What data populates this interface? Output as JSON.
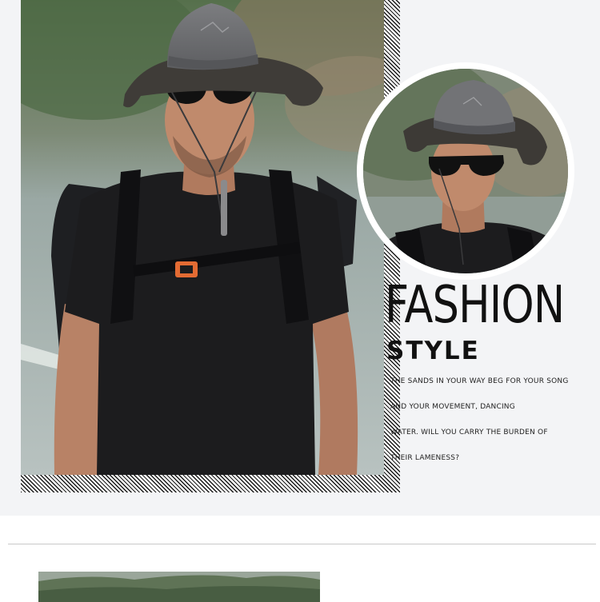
{
  "headline": "FASHION",
  "subheadline": "STYLE",
  "poem": [
    "THE SANDS IN YOUR WAY BEG FOR YOUR SONG",
    "AND YOUR MOVEMENT, DANCING",
    "WATER. WILL YOU CARRY THE BURDEN OF",
    "THEIR LAMENESS?"
  ],
  "images": {
    "main_photo": "man-in-bucket-hat-photo",
    "circle_photo": "hat-closeup-photo",
    "bottom_photo": "mountain-landscape-photo"
  },
  "colors": {
    "hat": "#6c6d6f",
    "shirt": "#1b1b1d",
    "buckle": "#e36b33",
    "background": "#f3f4f6"
  }
}
